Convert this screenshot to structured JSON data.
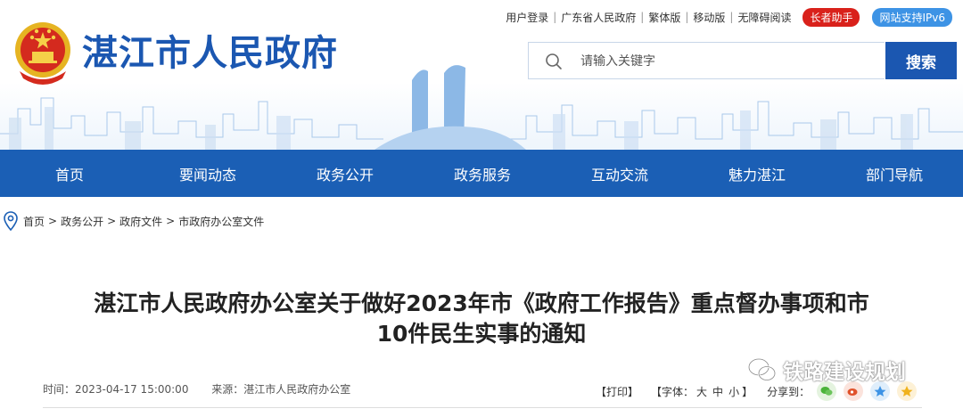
{
  "header": {
    "site_title": "湛江市人民政府",
    "top_links": [
      "用户登录",
      "广东省人民政府",
      "繁体版",
      "移动版",
      "无障碍阅读"
    ],
    "elder_button": "长者助手",
    "ipv6_badge": "网站支持IPv6",
    "search": {
      "placeholder": "请输入关键字",
      "button": "搜索"
    }
  },
  "nav": [
    "首页",
    "要闻动态",
    "政务公开",
    "政务服务",
    "互动交流",
    "魅力湛江",
    "部门导航"
  ],
  "breadcrumb": [
    "首页",
    "政务公开",
    "政府文件",
    "市政府办公室文件"
  ],
  "breadcrumb_sep": ">",
  "article": {
    "title_line1": "湛江市人民政府办公室关于做好2023年市《政府工作报告》重点督办事项和市",
    "title_line2": "10件民生实事的通知",
    "time_label": "时间：2023-04-17 15:00:00",
    "source_label": "来源：湛江市人民政府办公室",
    "print": "【打印】",
    "font_size_label": "【字体：",
    "font_sizes": [
      "大",
      "中",
      "小"
    ],
    "font_size_close": "】",
    "share_label": "分享到："
  },
  "watermark": "铁路建设规划",
  "colors": {
    "brand_blue": "#1b57b1",
    "nav_blue": "#1b5fb5",
    "elder_red": "#d9211b",
    "ipv6_blue": "#3d93e5"
  },
  "icons": [
    "national-emblem",
    "search-icon",
    "location-pin-icon",
    "wechat-icon",
    "weibo-icon",
    "qzone-icon",
    "star-icon"
  ]
}
